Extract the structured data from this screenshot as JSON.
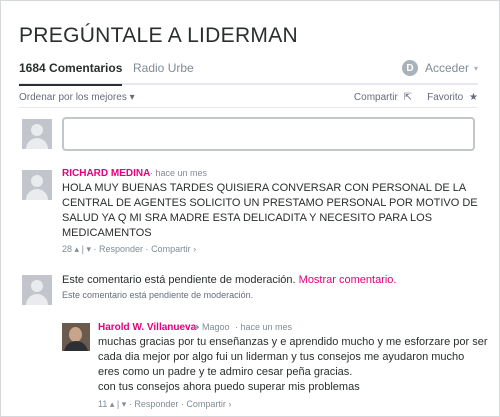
{
  "page": {
    "title": "PREGÚNTALE A LIDERMAN"
  },
  "nav": {
    "comments_tab": "1684 Comentarios",
    "site_tab": "Radio Urbe",
    "login_label": "Acceder",
    "login_icon": "disqus-d-icon",
    "login_caret": "▾"
  },
  "toolbar": {
    "sort_label": "Ordenar por los mejores",
    "sort_caret": "▾",
    "share_label": "Compartir",
    "share_icon": "⇱",
    "favorite_label": "Favorito",
    "favorite_icon": "★"
  },
  "colors": {
    "accent": "#e5007d",
    "text": "#2a2e2e",
    "muted": "#7f8c95"
  },
  "comments": [
    {
      "author": "RICHARD MEDINA",
      "time": "hace un mes",
      "lines": [
        "HOLA MUY BUENAS TARDES QUISIERA CONVERSAR CON PERSONAL DE LA",
        "CENTRAL DE AGENTES SOLICITO UN PRESTAMO PERSONAL POR MOTIVO DE",
        "SALUD YA Q MI SRA MADRE ESTA DELICADITA Y NECESITO PARA LOS",
        "MEDICAMENTOS"
      ],
      "votes": "28",
      "reply": "Responder",
      "share": "Compartir ›"
    },
    {
      "pending_text": "Este comentario está pendiente de moderación.",
      "show_link": "Mostrar comentario.",
      "note": "Este comentario está pendiente de moderación."
    },
    {
      "author": "Harold W. Villanueva",
      "reply_to": "Magoo",
      "time": "hace un mes",
      "lines": [
        "muchas gracias por tu enseñanzas y e aprendido mucho y me esforzare por ser",
        "cada dia mejor por algo fui un liderman y tus consejos me ayudaron mucho",
        "eres como un padre y te admiro cesar peña gracias.",
        "con tus consejos ahora puedo superar mis problemas"
      ],
      "votes": "11",
      "reply": "Responder",
      "share": "Compartir ›"
    }
  ]
}
